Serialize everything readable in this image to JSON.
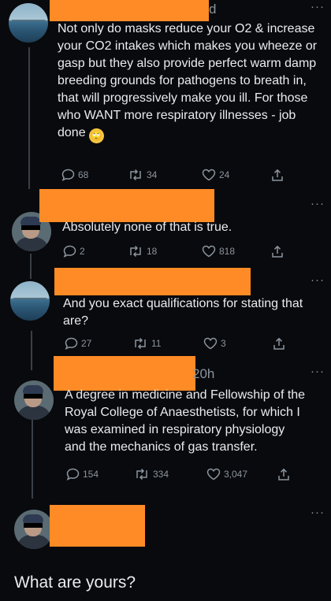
{
  "tweets": [
    {
      "handle_tail": "d",
      "text": "Not only do masks reduce your O2 & increase your CO2 intakes which makes you wheeze or gasp but they also provide perfect warm damp breeding grounds for pathogens to breath in, that will progressively make you ill. For those who WANT more respiratory illnesses - job done",
      "emoji": "🙄",
      "replies": "68",
      "retweets": "34",
      "likes": "24"
    },
    {
      "text": "Absolutely none of that is true.",
      "replies": "2",
      "retweets": "18",
      "likes": "818"
    },
    {
      "text": "And you exact qualifications for stating that are?",
      "replies": "27",
      "retweets": "11",
      "likes": "3"
    },
    {
      "handle_tail": "20h",
      "lines": [
        "A degree in medicine and Fellowship of the",
        "Royal College of Anaesthetists, for which I",
        "was examined in respiratory physiology",
        "and the mechanics of gas transfer."
      ],
      "replies": "154",
      "retweets": "334",
      "likes": "3,047"
    }
  ],
  "final_reply": "What are yours?",
  "more_label": "···",
  "icons": [
    "reply-icon",
    "retweet-icon",
    "like-icon",
    "share-icon"
  ],
  "colors": {
    "background": "#090a0d",
    "redaction": "#ff8b26",
    "text": "#e9ecef",
    "muted": "#8b949e"
  }
}
